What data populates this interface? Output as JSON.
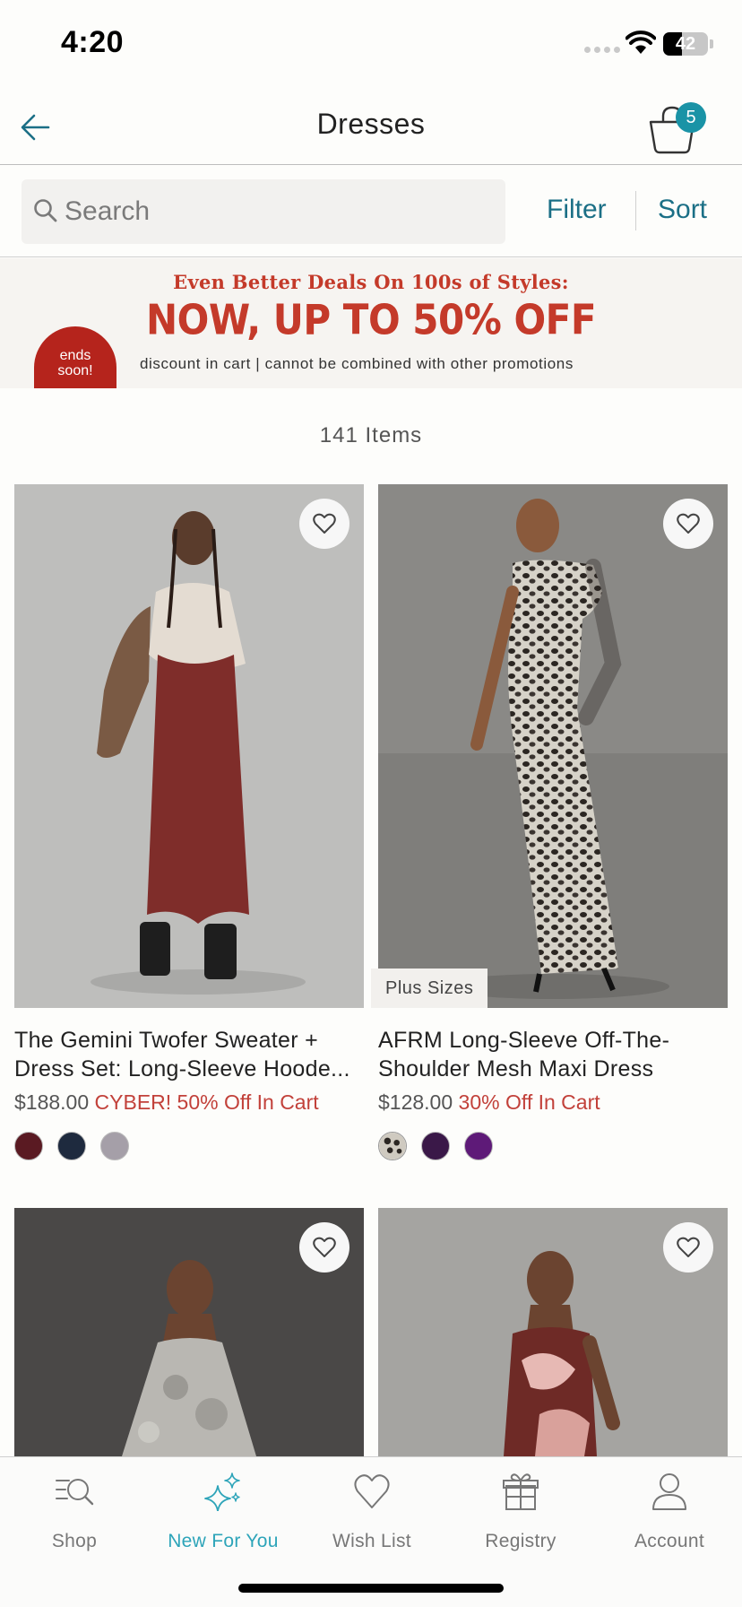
{
  "status_bar": {
    "time": "4:20",
    "battery": "42",
    "battery_level": 0.42
  },
  "header": {
    "title": "Dresses",
    "cart_count": "5"
  },
  "search": {
    "placeholder": "Search",
    "filter_label": "Filter",
    "sort_label": "Sort"
  },
  "promo": {
    "line1": "Even Better Deals On 100s of Styles:",
    "line2": "NOW, UP TO 50% OFF",
    "line3": "discount in cart | cannot be combined with other promotions",
    "badge_line1": "ends",
    "badge_line2": "soon!"
  },
  "item_count": "141 Items",
  "products": [
    {
      "name_line1": "The Gemini Twofer Sweater +",
      "name_line2": "Dress Set: Long-Sleeve Hoode...",
      "price": "$188.00",
      "promo": "CYBER! 50% Off In Cart",
      "swatches": [
        "#5a1a22",
        "#1e2a3e",
        "#a59fa8"
      ]
    },
    {
      "tag": "Plus Sizes",
      "name_line1": "AFRM Long-Sleeve Off-The-",
      "name_line2": "Shoulder Mesh Maxi Dress",
      "price": "$128.00",
      "promo": "30% Off In Cart",
      "swatches": [
        "leopard",
        "#3a1848",
        "#5e1a78"
      ]
    },
    {},
    {}
  ],
  "nav": [
    {
      "label": "Shop",
      "icon": "shop-search-icon"
    },
    {
      "label": "New For You",
      "icon": "sparkle-icon",
      "active": true
    },
    {
      "label": "Wish List",
      "icon": "heart-icon"
    },
    {
      "label": "Registry",
      "icon": "gift-icon"
    },
    {
      "label": "Account",
      "icon": "person-icon"
    }
  ],
  "colors": {
    "accent": "#1b6f86",
    "nav_active": "#2da4b9",
    "sale": "#c2413a",
    "promo_red": "#c43a2a",
    "badge": "#1a93a6"
  }
}
